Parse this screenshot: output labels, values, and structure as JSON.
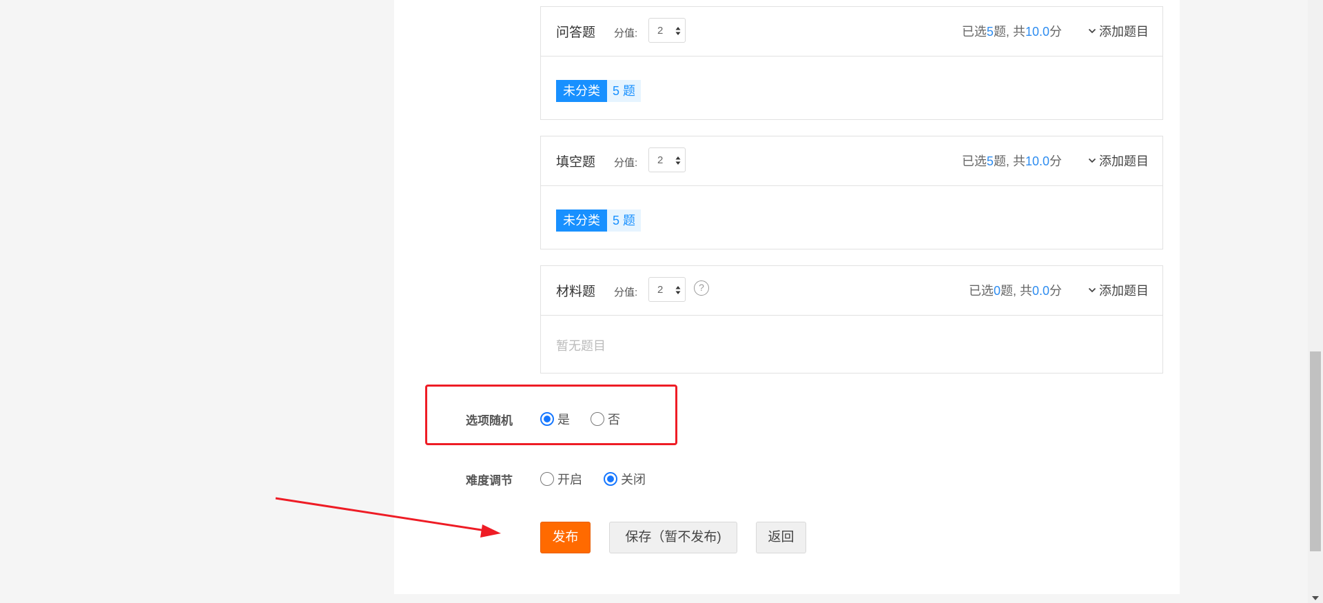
{
  "sections": [
    {
      "title": "问答题",
      "score_label": "分值:",
      "score_value": "2",
      "summary": {
        "prefix": "已选",
        "count": "5",
        "mid": "题, 共",
        "total": "10.0",
        "suffix": "分"
      },
      "add_label": "添加题目",
      "tag": {
        "name": "未分类",
        "count": "5 题"
      }
    },
    {
      "title": "填空题",
      "score_label": "分值:",
      "score_value": "2",
      "summary": {
        "prefix": "已选",
        "count": "5",
        "mid": "题, 共",
        "total": "10.0",
        "suffix": "分"
      },
      "add_label": "添加题目",
      "tag": {
        "name": "未分类",
        "count": "5 题"
      }
    },
    {
      "title": "材料题",
      "score_label": "分值:",
      "score_value": "2",
      "help_icon": "?",
      "summary": {
        "prefix": "已选",
        "count": "0",
        "mid": "题, 共",
        "total": "0.0",
        "suffix": "分"
      },
      "add_label": "添加题目",
      "empty_text": "暂无题目"
    }
  ],
  "options_random": {
    "label": "选项随机",
    "options": [
      {
        "label": "是",
        "checked": true
      },
      {
        "label": "否",
        "checked": false
      }
    ]
  },
  "difficulty": {
    "label": "难度调节",
    "options": [
      {
        "label": "开启",
        "checked": false
      },
      {
        "label": "关闭",
        "checked": true
      }
    ]
  },
  "buttons": {
    "publish": "发布",
    "save": "保存（暂不发布)",
    "back": "返回"
  },
  "colors": {
    "accent_blue": "#1890ff",
    "publish_orange": "#ff6a00",
    "annotation_red": "#ee1c25"
  }
}
